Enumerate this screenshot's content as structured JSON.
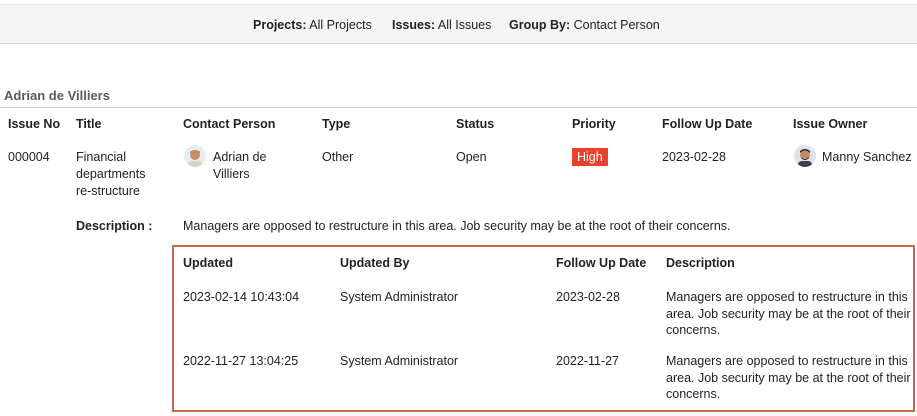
{
  "filters": {
    "projects_label": "Projects:",
    "projects_value": "All Projects",
    "issues_label": "Issues:",
    "issues_value": "All Issues",
    "groupby_label": "Group By:",
    "groupby_value": "Contact Person"
  },
  "group": {
    "title": "Adrian de Villiers"
  },
  "columns": [
    "Issue No",
    "Title",
    "Contact Person",
    "Type",
    "Status",
    "Priority",
    "Follow Up Date",
    "Issue Owner"
  ],
  "issue": {
    "issue_no": "000004",
    "title": "Financial departments re-structure",
    "contact_person": "Adrian de Villiers",
    "type": "Other",
    "status": "Open",
    "priority": "High",
    "priority_color": "#e8412c",
    "follow_up_date": "2023-02-28",
    "issue_owner": "Manny Sanchez",
    "description_label": "Description :",
    "description": "Managers are opposed to restructure in this area. Job security may be at the root of their concerns."
  },
  "history": {
    "columns": [
      "Updated",
      "Updated By",
      "Follow Up Date",
      "Description"
    ],
    "rows": [
      {
        "updated": "2023-02-14 10:43:04",
        "updated_by": "System Administrator",
        "follow_up_date": "2023-02-28",
        "description": "Managers are opposed to restructure in this area. Job security may be at the root of their concerns."
      },
      {
        "updated": "2022-11-27 13:04:25",
        "updated_by": "System Administrator",
        "follow_up_date": "2022-11-27",
        "description": "Managers are opposed to restructure in this area. Job security may be at the root of their concerns."
      }
    ]
  },
  "accent_border_color": "#c8654a"
}
